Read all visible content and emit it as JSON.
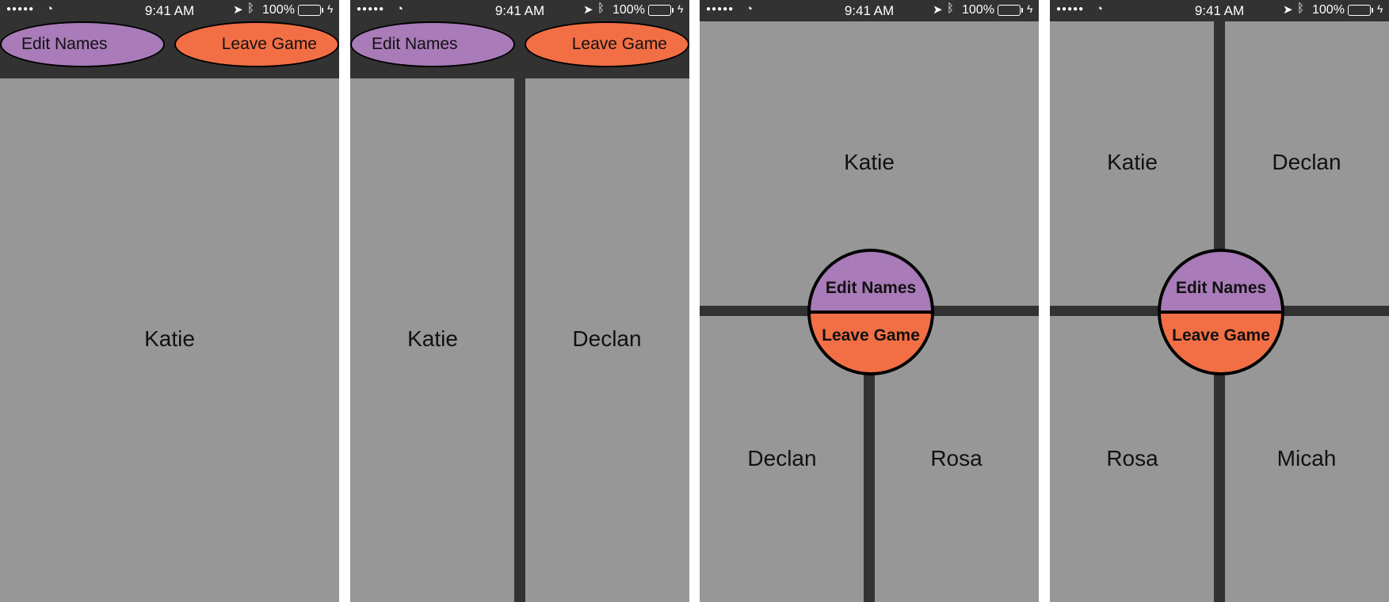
{
  "colors": {
    "bar": "#323232",
    "field": "#979797",
    "edit": "#a97bb8",
    "leave": "#f26f45",
    "battery": "#4cd964"
  },
  "status": {
    "signal": "●●●●●",
    "time": "9:41 AM",
    "battery_pct": "100%"
  },
  "buttons": {
    "edit_names": "Edit Names",
    "leave_game": "Leave Game"
  },
  "screens": [
    {
      "players": [
        "Katie"
      ]
    },
    {
      "players": [
        "Katie",
        "Declan"
      ]
    },
    {
      "players": [
        "Katie",
        "Declan",
        "Rosa"
      ]
    },
    {
      "players": [
        "Katie",
        "Declan",
        "Rosa",
        "Micah"
      ]
    }
  ]
}
